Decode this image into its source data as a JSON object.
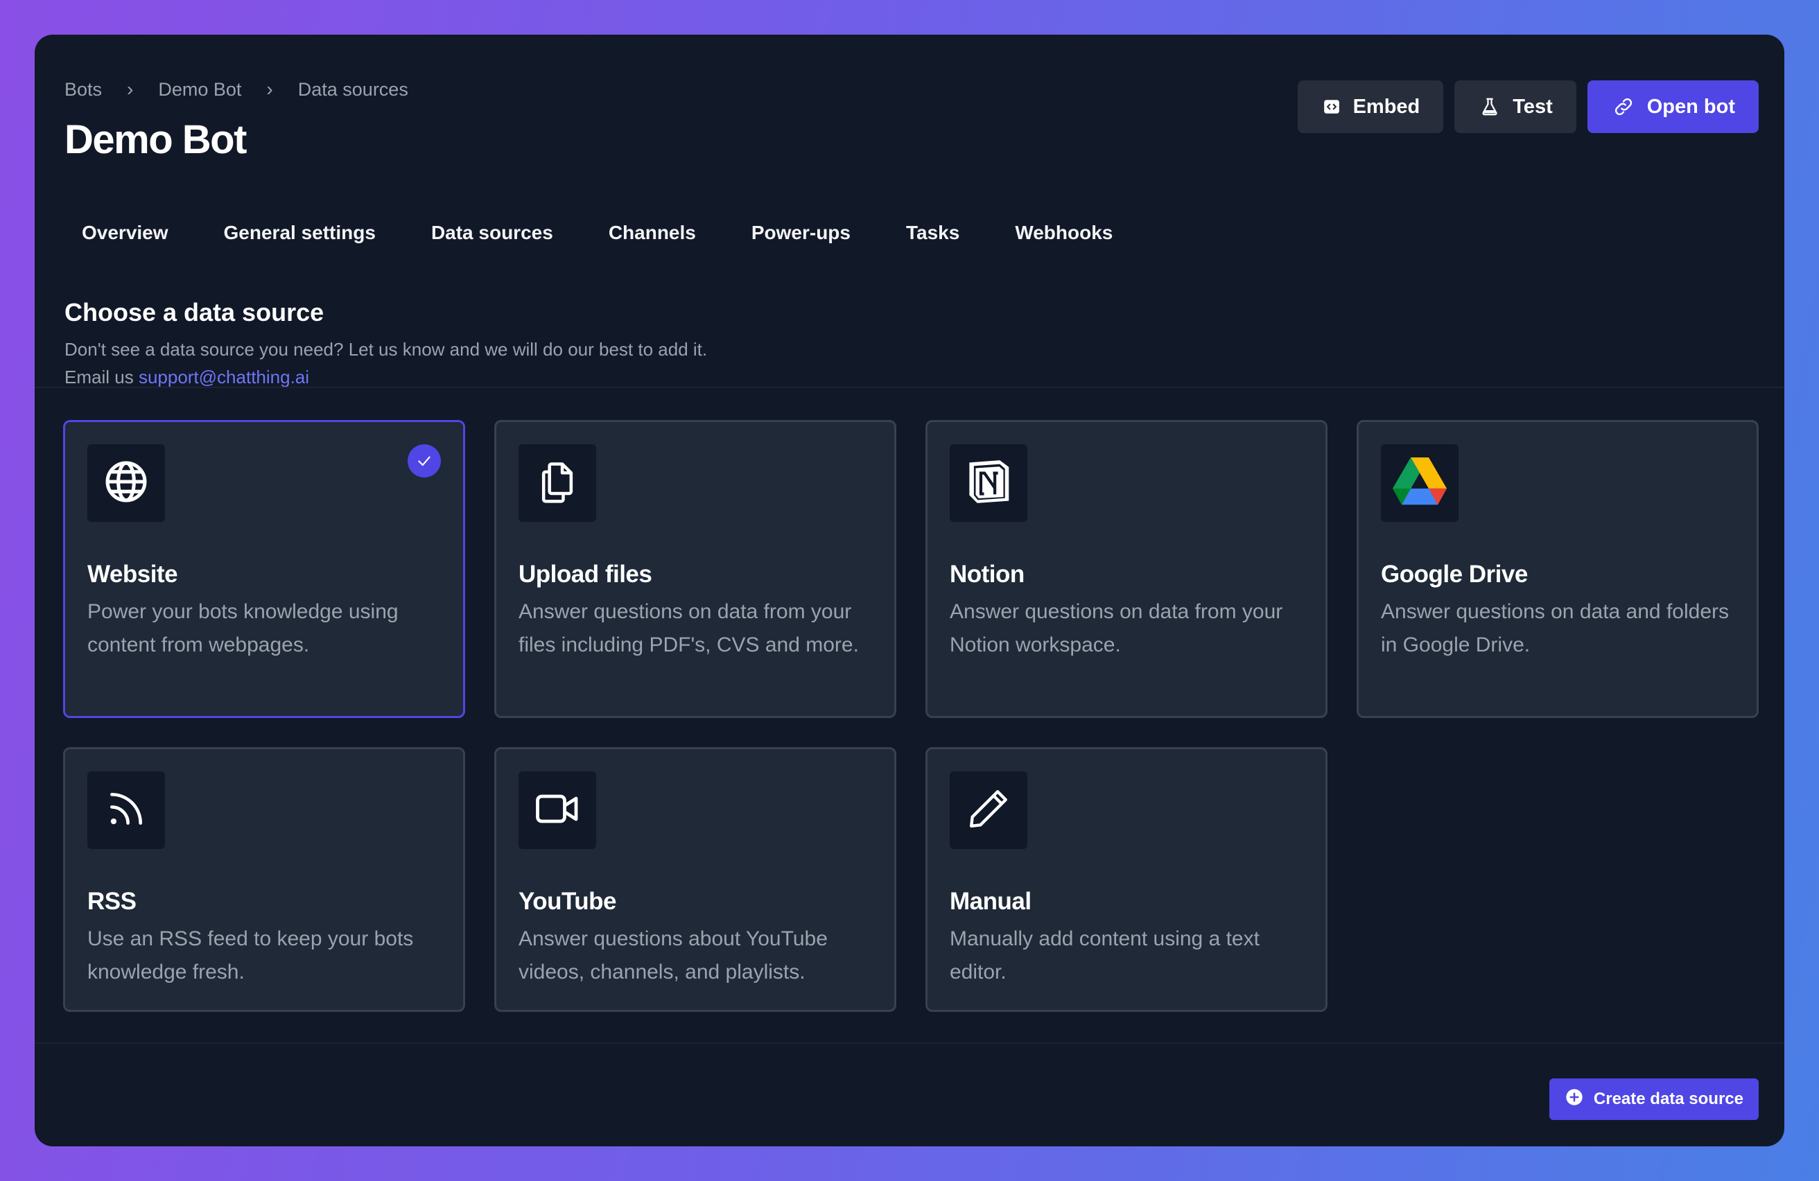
{
  "breadcrumb": [
    "Bots",
    "Demo Bot",
    "Data sources"
  ],
  "page_title": "Demo Bot",
  "actions": {
    "embed_label": "Embed",
    "test_label": "Test",
    "open_bot_label": "Open bot"
  },
  "tabs": [
    "Overview",
    "General settings",
    "Data sources",
    "Channels",
    "Power-ups",
    "Tasks",
    "Webhooks"
  ],
  "section": {
    "title": "Choose a data source",
    "description": "Don't see a data source you need? Let us know and we will do our best to add it.",
    "email_prefix": "Email us",
    "email": "support@chatthing.ai"
  },
  "sources": [
    {
      "title": "Website",
      "description": "Power your bots knowledge using content from webpages.",
      "icon": "globe-icon",
      "selected": true
    },
    {
      "title": "Upload files",
      "description": "Answer questions on data from your files including PDF's, CVS and more.",
      "icon": "files-icon",
      "selected": false
    },
    {
      "title": "Notion",
      "description": "Answer questions on data from your Notion workspace.",
      "icon": "notion-icon",
      "selected": false
    },
    {
      "title": "Google Drive",
      "description": "Answer questions on data and folders in Google Drive.",
      "icon": "google-drive-icon",
      "selected": false
    },
    {
      "title": "RSS",
      "description": "Use an RSS feed to keep your bots knowledge fresh.",
      "icon": "rss-icon",
      "selected": false
    },
    {
      "title": "YouTube",
      "description": "Answer questions about YouTube videos, channels, and playlists.",
      "icon": "video-camera-icon",
      "selected": false
    },
    {
      "title": "Manual",
      "description": "Manually add content using a text editor.",
      "icon": "pencil-icon",
      "selected": false
    }
  ],
  "create_button_label": "Create data source",
  "colors": {
    "accent": "#4f46e5",
    "panel": "#111827",
    "card": "#1f2937",
    "card_border": "#374151",
    "muted_text": "#9ca3af",
    "link": "#6f76f5"
  }
}
